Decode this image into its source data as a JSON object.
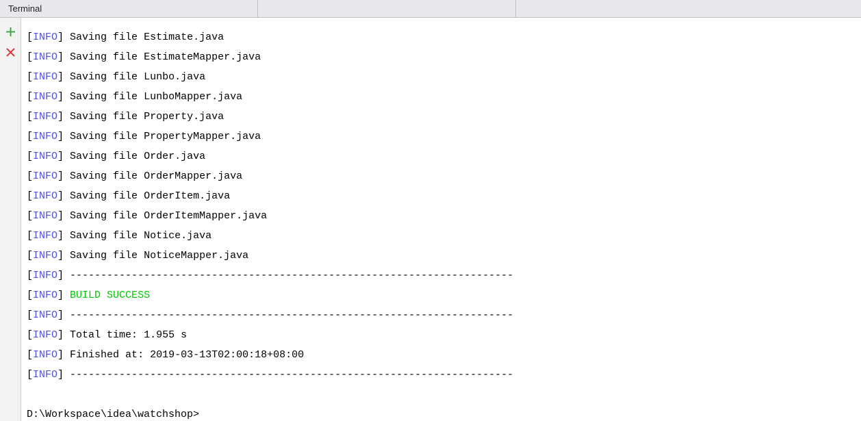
{
  "header": {
    "tab1": "Terminal",
    "tab2": "",
    "tab3": ""
  },
  "gutter": {
    "add_icon": "+",
    "close_icon": "×"
  },
  "log": {
    "tag": "INFO",
    "lines": [
      {
        "type": "text",
        "msg": "Saving file Estimate.java"
      },
      {
        "type": "text",
        "msg": "Saving file EstimateMapper.java"
      },
      {
        "type": "text",
        "msg": "Saving file Lunbo.java"
      },
      {
        "type": "text",
        "msg": "Saving file LunboMapper.java"
      },
      {
        "type": "text",
        "msg": "Saving file Property.java"
      },
      {
        "type": "text",
        "msg": "Saving file PropertyMapper.java"
      },
      {
        "type": "text",
        "msg": "Saving file Order.java"
      },
      {
        "type": "text",
        "msg": "Saving file OrderMapper.java"
      },
      {
        "type": "text",
        "msg": "Saving file OrderItem.java"
      },
      {
        "type": "text",
        "msg": "Saving file OrderItemMapper.java"
      },
      {
        "type": "text",
        "msg": "Saving file Notice.java"
      },
      {
        "type": "text",
        "msg": "Saving file NoticeMapper.java"
      },
      {
        "type": "sep",
        "msg": "------------------------------------------------------------------------"
      },
      {
        "type": "success",
        "msg": "BUILD SUCCESS"
      },
      {
        "type": "sep",
        "msg": "------------------------------------------------------------------------"
      },
      {
        "type": "text",
        "msg": "Total time: 1.955 s"
      },
      {
        "type": "text",
        "msg": "Finished at: 2019-03-13T02:00:18+08:00"
      },
      {
        "type": "sep",
        "msg": "------------------------------------------------------------------------"
      }
    ],
    "prompt": "D:\\Workspace\\idea\\watchshop>"
  }
}
